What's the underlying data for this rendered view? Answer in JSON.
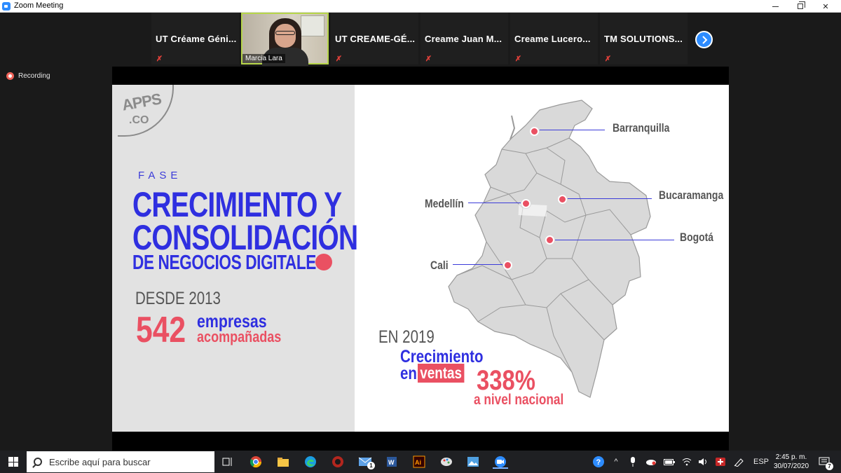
{
  "window": {
    "title": "Zoom Meeting"
  },
  "participants": [
    {
      "name": "UT Créame Géni...",
      "muted": true,
      "video": false
    },
    {
      "name": "Marcia Lara",
      "muted": false,
      "video": true
    },
    {
      "name": "UT CREAME-GÉ...",
      "muted": true,
      "video": false
    },
    {
      "name": "Creame Juan M...",
      "muted": true,
      "video": false
    },
    {
      "name": "Creame Lucero...",
      "muted": true,
      "video": false
    },
    {
      "name": "TM SOLUTIONS...",
      "muted": true,
      "video": false
    }
  ],
  "recording": {
    "label": "Recording"
  },
  "slide": {
    "logo": {
      "apps": "APPS",
      "co": ".CO"
    },
    "fase": "FASE",
    "heading_line1": "CRECIMIENTO Y",
    "heading_line2": "CONSOLIDACIÓN",
    "heading_line3": "DE NEGOCIOS DIGITALES",
    "desde": "DESDE 2013",
    "companies_count": "542",
    "companies_word1": "empresas",
    "companies_word2": "acompañadas",
    "cities": {
      "barranquilla": "Barranquilla",
      "bucaramanga": "Bucaramanga",
      "medellin": "Medellín",
      "bogota": "Bogotá",
      "cali": "Cali"
    },
    "year_label": "EN 2019",
    "growth_word": "Crecimiento",
    "growth_en": "en",
    "growth_ventas": "ventas",
    "growth_percent": "338%",
    "growth_scope": "a nivel nacional"
  },
  "taskbar": {
    "search_placeholder": "Escribe aquí para buscar",
    "mail_badge": "1",
    "language": "ESP",
    "time": "2:45 p. m.",
    "date": "30/07/2020",
    "notification_count": "7"
  },
  "colors": {
    "accent_blue": "#2f2fe0",
    "accent_pink": "#ea5062",
    "zoom_blue": "#2d8cff"
  }
}
